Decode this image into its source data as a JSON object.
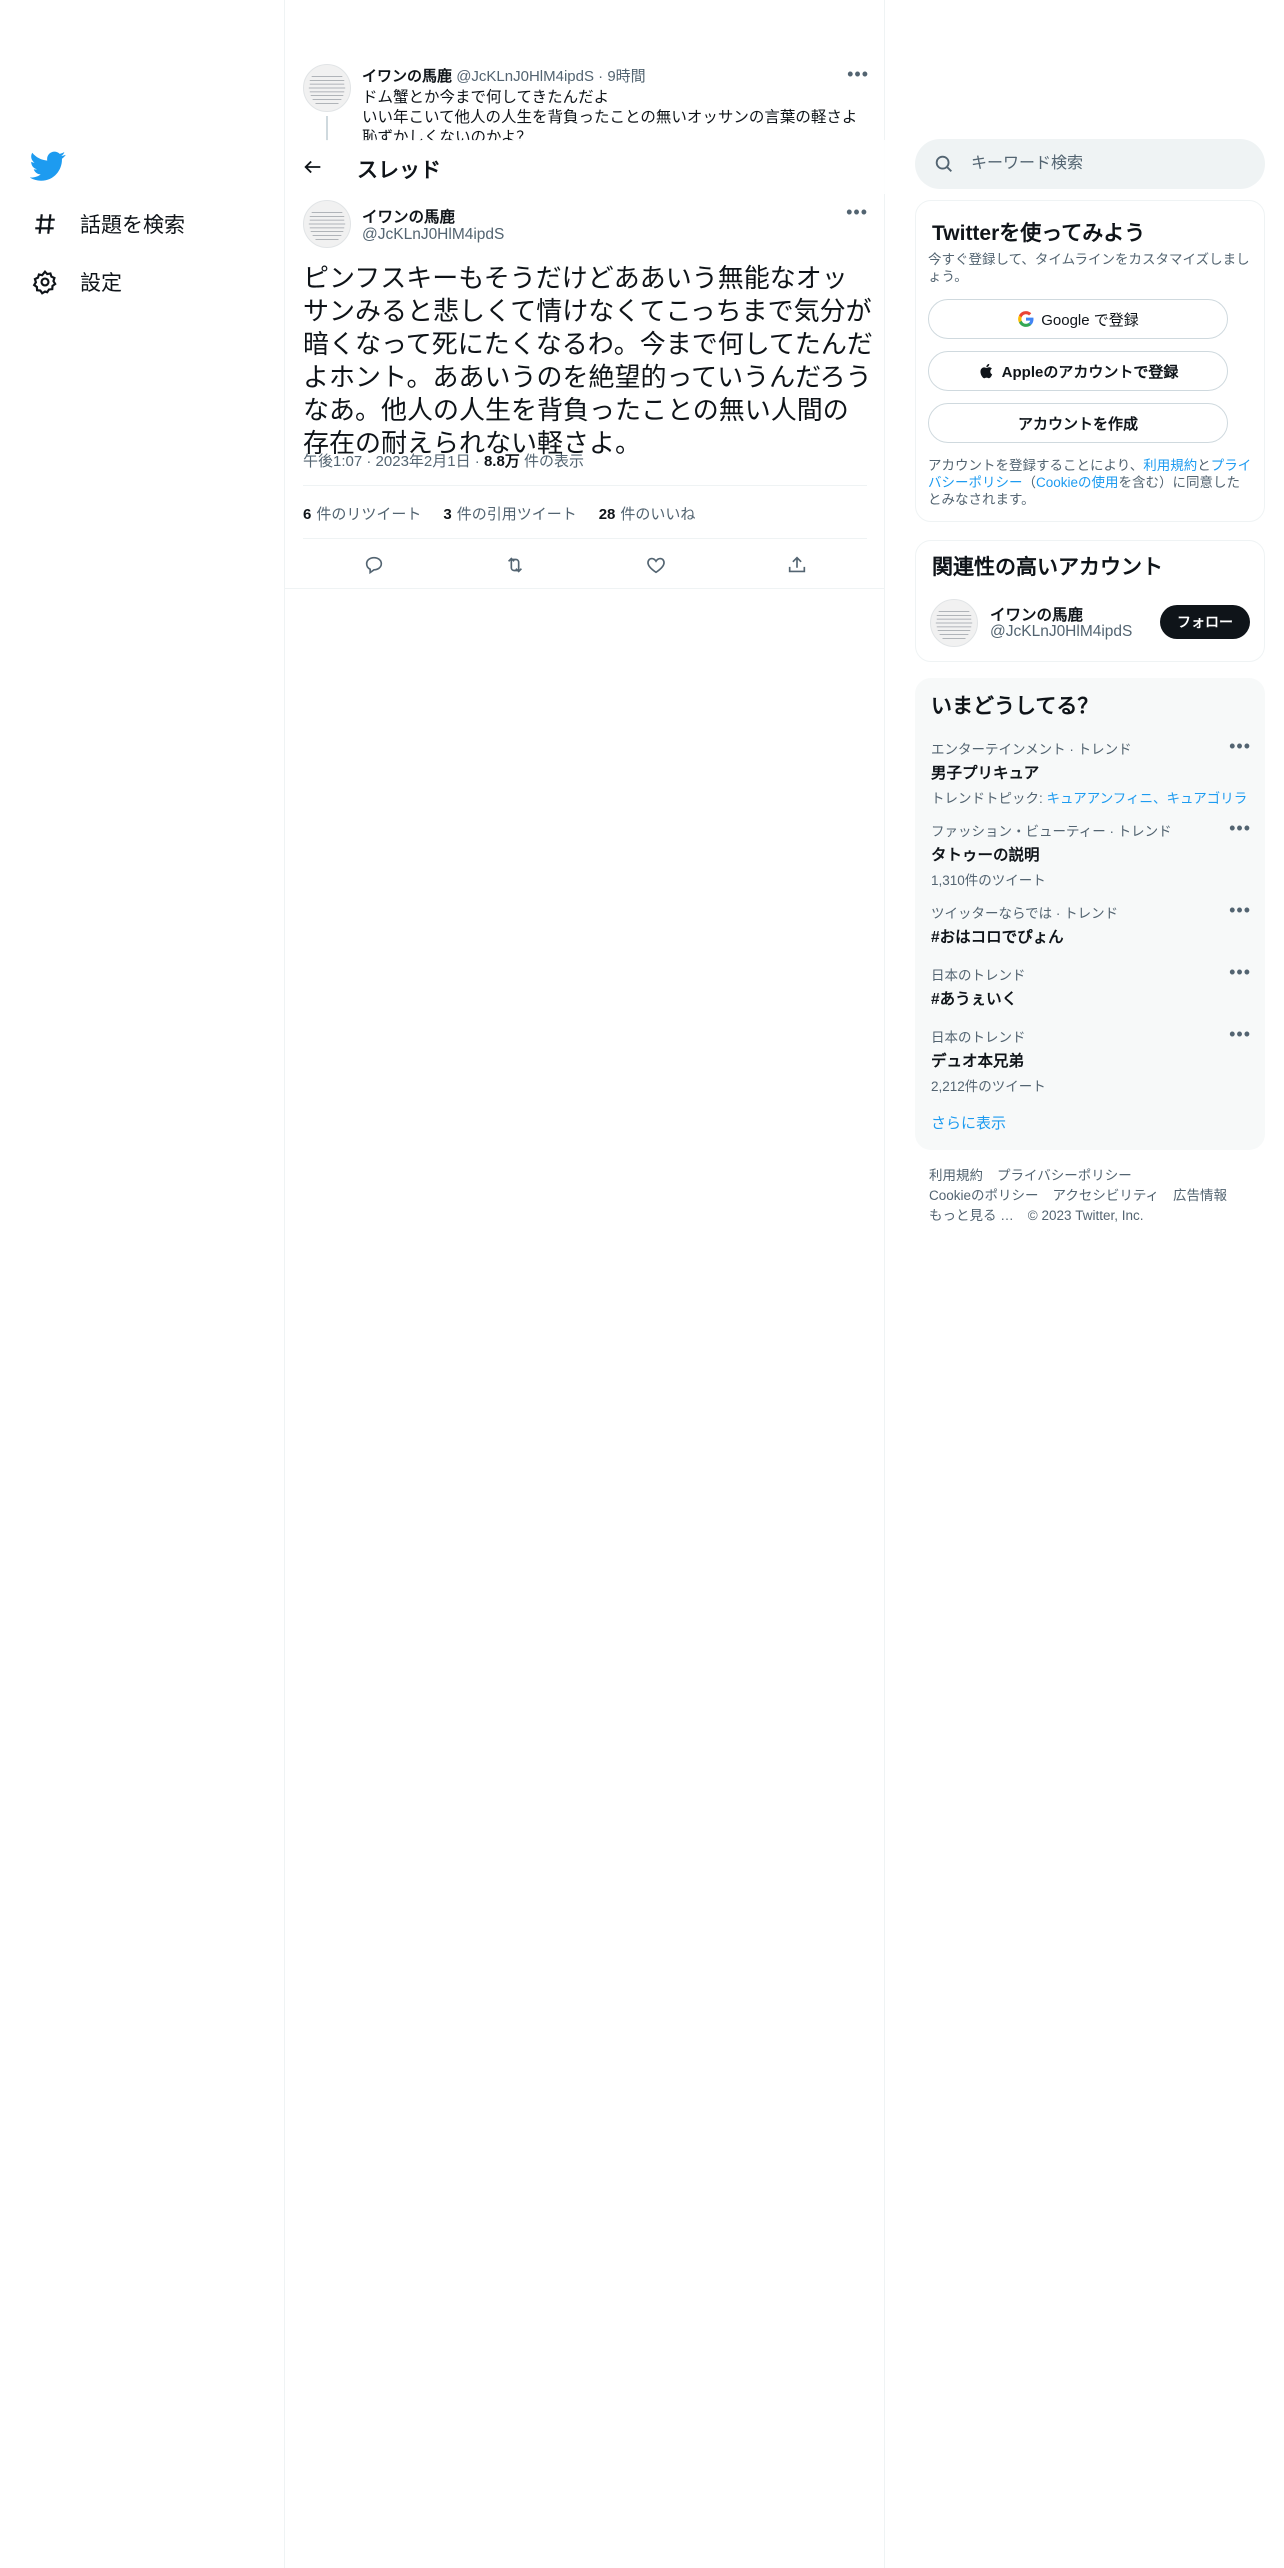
{
  "nav": {
    "items": [
      {
        "label": "話題を検索",
        "icon": "hashtag-icon"
      },
      {
        "label": "設定",
        "icon": "gear-icon"
      }
    ]
  },
  "prev_tweet": {
    "name": "イワンの馬鹿",
    "handle": "@JcKLnJ0HlM4ipdS",
    "separator": "·",
    "time": "9時間",
    "lines": [
      "ドム蟹とか今まで何してきたんだよ",
      "いい年こいて他人の人生を背負ったことの無いオッサンの言葉の軽さよ",
      "恥ずかしくないのかよ？"
    ]
  },
  "header": {
    "title": "スレッド"
  },
  "tweet": {
    "name": "イワンの馬鹿",
    "handle": "@JcKLnJ0HlM4ipdS",
    "text": "ピンフスキーもそうだけどああいう無能なオッサンみると悲しくて情けなくてこっちまで気分が暗くなって死にたくなるわ。今まで何してたんだよホント。ああいうのを絶望的っていうんだろうなあ。他人の人生を背負ったことの無い人間の存在の耐えられない軽さよ。",
    "time": "午後1:07",
    "date": "2023年2月1日",
    "views": "8.8万",
    "views_label": "件の表示",
    "dot": "·",
    "stats": [
      {
        "count": "6",
        "label": "件のリツイート"
      },
      {
        "count": "3",
        "label": "件の引用ツイート"
      },
      {
        "count": "28",
        "label": "件のいいね"
      }
    ]
  },
  "search": {
    "placeholder": "キーワード検索"
  },
  "signup": {
    "title": "Twitterを使ってみよう",
    "subtitle": "今すぐ登録して、タイムラインをカスタマイズしましょう。",
    "google": "Google で登録",
    "apple": "Appleのアカウントで登録",
    "create": "アカウントを作成",
    "legal_1": "アカウントを登録することにより、",
    "legal_terms": "利用規約",
    "legal_and": "と",
    "legal_privacy": "プライバシーポリシー",
    "legal_paren_open": "（",
    "legal_cookie": "Cookieの使用",
    "legal_2": "を含む）に同意したとみなされます。"
  },
  "related": {
    "title": "関連性の高いアカウント",
    "name": "イワンの馬鹿",
    "handle": "@JcKLnJ0HlM4ipdS",
    "follow": "フォロー"
  },
  "trends": {
    "title": "いまどうしてる？",
    "items": [
      {
        "category": "エンターテインメント · トレンド",
        "name": "男子プリキュア",
        "sub_prefix": "トレンドトピック: ",
        "sub_links": "キュアアンフィニ、キュアゴリラ",
        "sub": ""
      },
      {
        "category": "ファッション・ビューティー · トレンド",
        "name": "タトゥーの説明",
        "sub": "1,310件のツイート"
      },
      {
        "category": "ツイッターならでは · トレンド",
        "name": "#おはコロでぴょん",
        "sub": ""
      },
      {
        "category": "日本のトレンド",
        "name": "#あうぇいく",
        "sub": ""
      },
      {
        "category": "日本のトレンド",
        "name": "デュオ本兄弟",
        "sub": "2,212件のツイート"
      }
    ],
    "show_more": "さらに表示"
  },
  "footer": {
    "links": [
      "利用規約",
      "プライバシーポリシー",
      "Cookieのポリシー",
      "アクセシビリティ",
      "広告情報",
      "もっと見る …"
    ],
    "copyright": "© 2023 Twitter, Inc."
  },
  "colors": {
    "accent": "#1d9bf0",
    "text": "#0f1419",
    "muted": "#536471",
    "border": "#eff3f4"
  }
}
